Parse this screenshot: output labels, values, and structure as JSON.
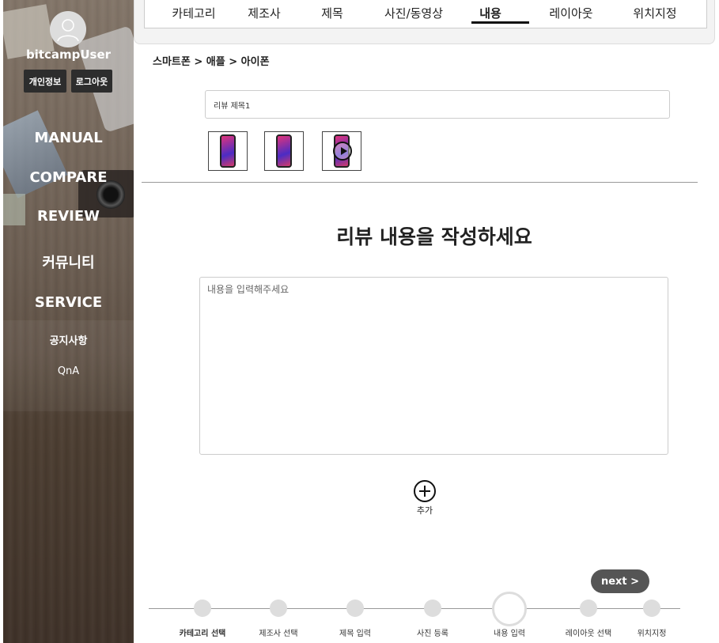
{
  "sidebar": {
    "username": "bitcampUser",
    "profile_button": "개인정보",
    "logout_button": "로그아웃",
    "nav": [
      "MANUAL",
      "COMPARE",
      "REVIEW",
      "커뮤니티",
      "SERVICE"
    ],
    "sub_nav": [
      "공지사항",
      "QnA"
    ]
  },
  "tabs": {
    "items": [
      "카테고리",
      "제조사",
      "제목",
      "사진/동영상",
      "내용",
      "레이아웃",
      "위치지정"
    ],
    "active": "내용"
  },
  "breadcrumb": "스마트폰 > 애플 > 아이폰",
  "title_input": {
    "value": "리뷰 제목1"
  },
  "heading": "리뷰 내용을 작성하세요",
  "content": {
    "placeholder": "내용을 입력해주세요"
  },
  "add": {
    "label": "추가"
  },
  "next_button": "next >",
  "steps": [
    "카테고리 선택",
    "제조사 선택",
    "제목 입력",
    "사진 등록",
    "내용 입력",
    "레이아웃 선택",
    "위치지정"
  ],
  "current_step": "내용 입력"
}
